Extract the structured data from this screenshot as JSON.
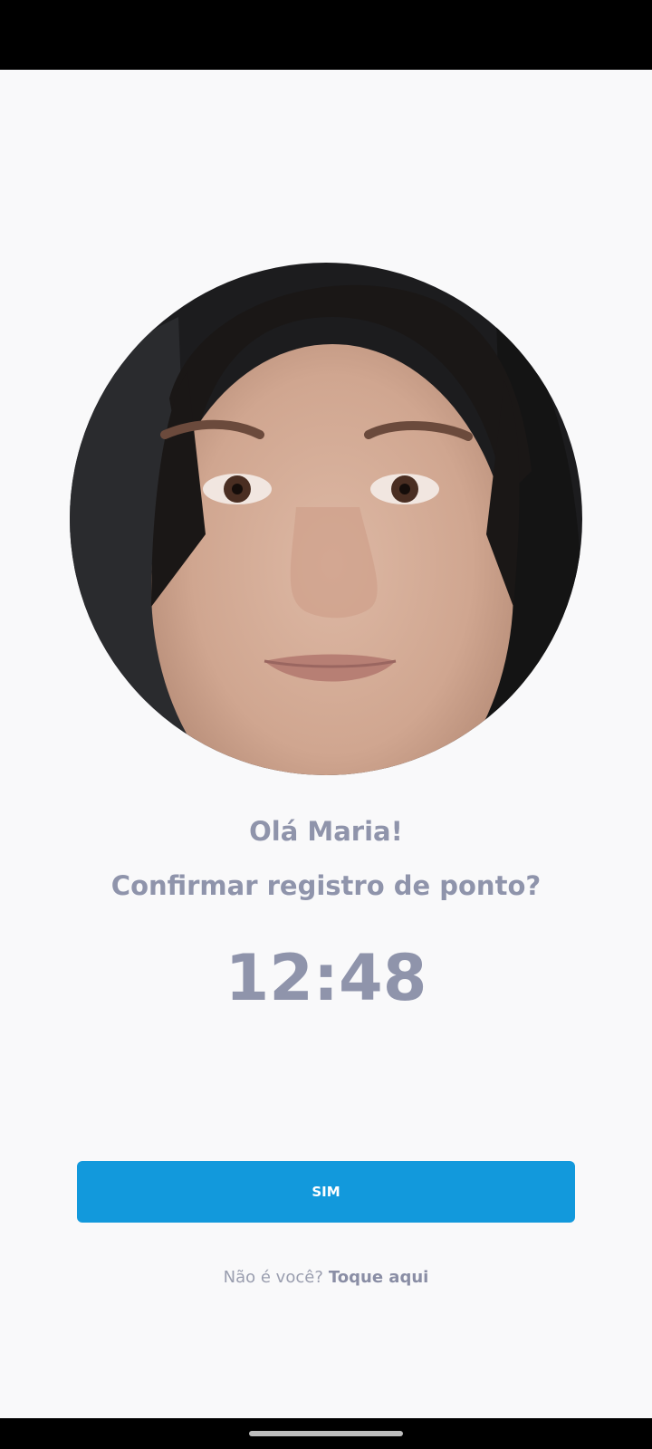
{
  "greeting": "Olá Maria!",
  "question": "Confirmar registro de ponto?",
  "time": "12:48",
  "confirm_button": {
    "label": "SIM"
  },
  "not_you": {
    "label": "Não é você?",
    "link": "Toque aqui"
  },
  "colors": {
    "background": "#f9f9fa",
    "text": "#8f94ab",
    "button": "#1299dc",
    "button_text": "#ffffff"
  }
}
